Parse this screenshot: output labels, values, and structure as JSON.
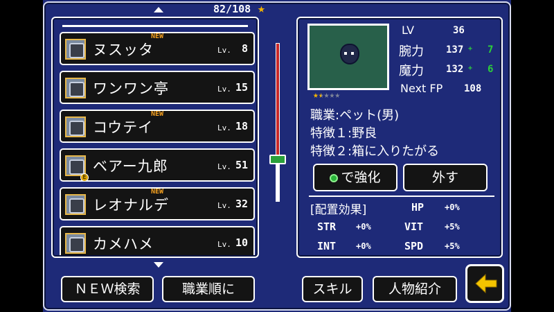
{
  "header": {
    "count": "82/108",
    "count_icon": "star-icon",
    "accent": "#f4b400"
  },
  "list": {
    "items": [
      {
        "name": "ヌスッタ",
        "lv_label": "Lv.",
        "level": "8",
        "new_badge": "NEW",
        "equipped": false
      },
      {
        "name": "ワンワン亭",
        "lv_label": "Lv.",
        "level": "15",
        "new_badge": "",
        "equipped": false
      },
      {
        "name": "コウテイ",
        "lv_label": "Lv.",
        "level": "18",
        "new_badge": "NEW",
        "equipped": false
      },
      {
        "name": "ベアー九郎",
        "lv_label": "Lv.",
        "level": "51",
        "new_badge": "",
        "equipped": true,
        "equip_mark": "E"
      },
      {
        "name": "レオナルデ",
        "lv_label": "Lv.",
        "level": "32",
        "new_badge": "NEW",
        "equipped": false
      },
      {
        "name": "カメハメ",
        "lv_label": "Lv.",
        "level": "10",
        "new_badge": "",
        "equipped": false
      }
    ]
  },
  "slider": {
    "position_fraction": 0.75
  },
  "detail": {
    "lv_label": "LV",
    "lv_value": "36",
    "power_label": "腕力",
    "power_value": "137",
    "power_bonus": "7",
    "magic_label": "魔力",
    "magic_value": "132",
    "magic_bonus": "6",
    "plus": "+",
    "next_fp_label": "Next FP",
    "next_fp_value": "108",
    "stars_filled": 1.5,
    "stars_total": 5,
    "job": "職業:ペット(男)",
    "trait1": "特徴１:野良",
    "trait2": "特徴２:箱に入りたがる",
    "strengthen_label": "で強化",
    "remove_label": "外す",
    "effects": {
      "title": "[配置効果]",
      "hp_label": "HP",
      "hp_value": "+0%",
      "str_label": "STR",
      "str_value": "+0%",
      "vit_label": "VIT",
      "vit_value": "+5%",
      "int_label": "INT",
      "int_value": "+0%",
      "spd_label": "SPD",
      "spd_value": "+5%"
    }
  },
  "bottom": {
    "new_search": "ＮＥＷ検索",
    "sort_job": "職業順に",
    "skill": "スキル",
    "profile": "人物紹介",
    "back_icon": "back-arrow-icon"
  },
  "colors": {
    "panel_bg": "#1e2a78",
    "item_bg": "#141414",
    "bonus_green": "#2ccf3a",
    "new_orange": "#f4a020",
    "portrait_bg": "#28604a"
  }
}
